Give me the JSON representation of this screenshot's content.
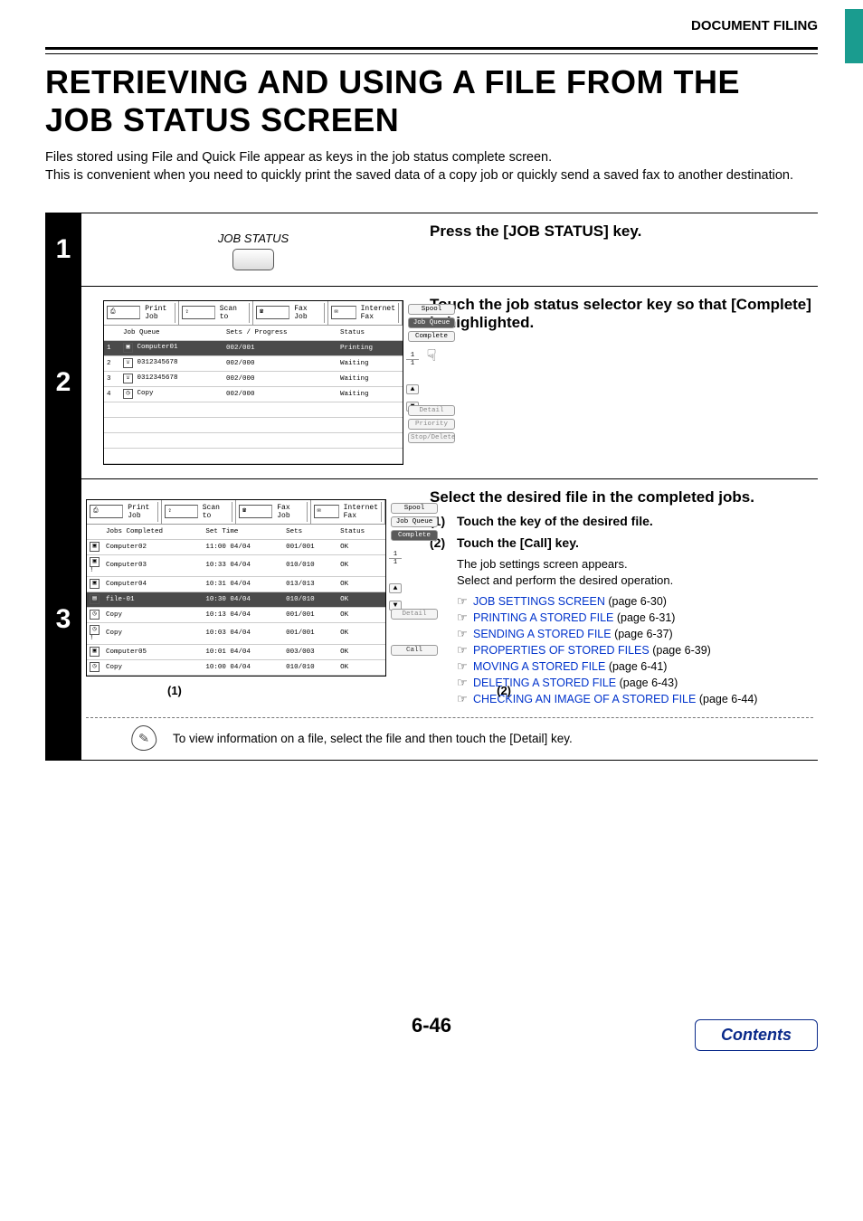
{
  "header": {
    "section": "DOCUMENT FILING"
  },
  "title": "RETRIEVING AND USING A FILE FROM THE JOB STATUS SCREEN",
  "intro": "Files stored using File and Quick File appear as keys in the job status complete screen.\nThis is convenient when you need to quickly print the saved data of a copy job or quickly send a saved fax to another destination.",
  "steps": {
    "s1": {
      "num": "1",
      "graphic_label": "JOB STATUS",
      "title": "Press the [JOB STATUS] key."
    },
    "s2": {
      "num": "2",
      "title": "Touch the job status selector key so that [Complete] is highlighted.",
      "panel": {
        "tabs": [
          "Print Job",
          "Scan to",
          "Fax Job",
          "Internet Fax"
        ],
        "headers": [
          "",
          "Job Queue",
          "Sets / Progress",
          "Status"
        ],
        "rows": [
          {
            "n": "1",
            "icon": "pc",
            "name": "Computer01",
            "sets": "002/001",
            "status": "Printing",
            "hl": true
          },
          {
            "n": "2",
            "icon": "ph",
            "name": "0312345678",
            "sets": "002/000",
            "status": "Waiting"
          },
          {
            "n": "3",
            "icon": "ph",
            "name": "0312345678",
            "sets": "002/000",
            "status": "Waiting"
          },
          {
            "n": "4",
            "icon": "cp",
            "name": "Copy",
            "sets": "002/000",
            "status": "Waiting"
          }
        ],
        "side": [
          "Spool",
          "Job Queue",
          "Complete"
        ],
        "side_hl_index": 1,
        "pagecount": [
          "1",
          "1"
        ],
        "lower": [
          "Detail",
          "Priority",
          "Stop/Delete"
        ]
      }
    },
    "s3": {
      "num": "3",
      "title": "Select the desired file in the completed jobs.",
      "sub1_num": "(1)",
      "sub1_text": "Touch the key of the desired file.",
      "sub2_num": "(2)",
      "sub2_text": "Touch the [Call] key.",
      "desc1": "The job settings screen appears.",
      "desc2": "Select and perform the desired operation.",
      "links": [
        {
          "t": "JOB SETTINGS SCREEN",
          "p": " (page 6-30)"
        },
        {
          "t": "PRINTING A STORED FILE",
          "p": " (page 6-31)"
        },
        {
          "t": "SENDING A STORED FILE",
          "p": " (page 6-37)"
        },
        {
          "t": "PROPERTIES OF STORED FILES",
          "p": " (page 6-39)"
        },
        {
          "t": "MOVING A STORED FILE",
          "p": " (page 6-41)"
        },
        {
          "t": "DELETING A STORED FILE",
          "p": " (page 6-43)"
        },
        {
          "t": "CHECKING AN IMAGE OF A STORED FILE",
          "p": " (page 6-44)"
        }
      ],
      "callout1": "(1)",
      "callout2": "(2)",
      "panel": {
        "tabs": [
          "Print Job",
          "Scan to",
          "Fax Job",
          "Internet Fax"
        ],
        "headers": [
          "",
          "Jobs Completed",
          "Set Time",
          "Sets",
          "Status"
        ],
        "rows": [
          {
            "icon": "pc",
            "name": "Computer02",
            "time": "11:00 04/04",
            "sets": "001/001",
            "status": "OK"
          },
          {
            "icon": "pc",
            "name": "Computer03",
            "time": "10:33 04/04",
            "sets": "010/010",
            "status": "OK",
            "excl": true
          },
          {
            "icon": "pc",
            "name": "Computer04",
            "time": "10:31 04/04",
            "sets": "013/013",
            "status": "OK"
          },
          {
            "icon": "fl",
            "name": "file-01",
            "time": "10:30 04/04",
            "sets": "010/010",
            "status": "OK",
            "hl": true
          },
          {
            "icon": "cp",
            "name": "Copy",
            "time": "10:13 04/04",
            "sets": "001/001",
            "status": "OK"
          },
          {
            "icon": "cp",
            "name": "Copy",
            "time": "10:03 04/04",
            "sets": "001/001",
            "status": "OK",
            "excl": true
          },
          {
            "icon": "pc",
            "name": "Computer05",
            "time": "10:01 04/04",
            "sets": "003/003",
            "status": "OK"
          },
          {
            "icon": "cp",
            "name": "Copy",
            "time": "10:00 04/04",
            "sets": "010/010",
            "status": "OK"
          }
        ],
        "side": [
          "Spool",
          "Job Queue",
          "Complete"
        ],
        "side_hl_index": 2,
        "pagecount": [
          "1",
          "1"
        ],
        "lower": [
          "Detail"
        ],
        "call_btn": "Call"
      },
      "note": "To view information on a file, select the file and then touch the [Detail] key."
    }
  },
  "footer": {
    "page": "6-46",
    "contents": "Contents"
  }
}
